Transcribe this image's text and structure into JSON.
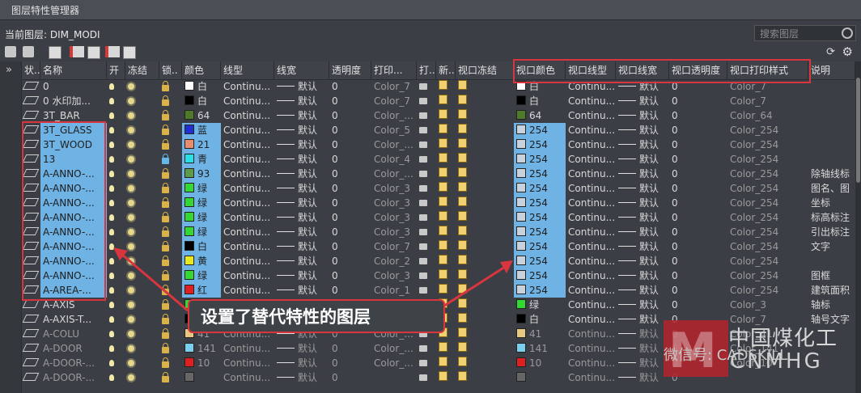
{
  "window": {
    "title": "图层特性管理器"
  },
  "current_layer": {
    "label": "当前图层: DIM_MODI"
  },
  "search": {
    "placeholder": "搜索图层"
  },
  "columns": [
    "状..",
    "名称",
    "开",
    "冻结",
    "锁..",
    "颜色",
    "线型",
    "线宽",
    "透明度",
    "打印...",
    "打..",
    "新..",
    "视口冻结",
    "视口颜色",
    "视口线型",
    "视口线宽",
    "视口透明度",
    "视口打印样式",
    "说明"
  ],
  "rows": [
    {
      "name": "0",
      "color": "白",
      "swatch": "#ffffff",
      "ltype": "Continu...",
      "lw": "默认",
      "tr": "0",
      "ps": "Color_7",
      "vpc": "白",
      "vpsw": "#ffffff",
      "vpl": "Continu...",
      "vplw": "默认",
      "vptr": "0",
      "vpps": "Color_7",
      "desc": "",
      "hl": false,
      "dim": false
    },
    {
      "name": "0 水印加...",
      "color": "白",
      "swatch": "#000000",
      "ltype": "Continu...",
      "lw": "默认",
      "tr": "0",
      "ps": "Color_7",
      "vpc": "白",
      "vpsw": "#000000",
      "vpl": "Continu...",
      "vplw": "默认",
      "vptr": "0",
      "vpps": "Color_7",
      "desc": "",
      "hl": false,
      "dim": false
    },
    {
      "name": "3T_BAR",
      "color": "64",
      "swatch": "#4e7a2a",
      "ltype": "Continu...",
      "lw": "默认",
      "tr": "0",
      "ps": "Color_...",
      "vpc": "64",
      "vpsw": "#4e7a2a",
      "vpl": "Continu...",
      "vplw": "默认",
      "vptr": "0",
      "vpps": "Color_64",
      "desc": "",
      "hl": false,
      "dim": false
    },
    {
      "name": "3T_GLASS",
      "color": "蓝",
      "swatch": "#2330d0",
      "ltype": "Continu...",
      "lw": "默认",
      "tr": "0",
      "ps": "Color_5",
      "vpc": "254",
      "vpsw": "#c8d2dc",
      "vpl": "Continu...",
      "vplw": "默认",
      "vptr": "0",
      "vpps": "Color_254",
      "desc": "",
      "hl": true,
      "dim": false
    },
    {
      "name": "3T_WOOD",
      "color": "21",
      "swatch": "#e58d6c",
      "ltype": "Continu...",
      "lw": "默认",
      "tr": "0",
      "ps": "Color_...",
      "vpc": "254",
      "vpsw": "#c8d2dc",
      "vpl": "Continu...",
      "vplw": "默认",
      "vptr": "0",
      "vpps": "Color_254",
      "desc": "",
      "hl": true,
      "dim": false
    },
    {
      "name": "13",
      "color": "青",
      "swatch": "#27e0e8",
      "ltype": "Continu...",
      "lw": "默认",
      "tr": "0",
      "ps": "Color_4",
      "vpc": "254",
      "vpsw": "#c8d2dc",
      "vpl": "Continu...",
      "vplw": "默认",
      "vptr": "0",
      "vpps": "Color_254",
      "desc": "",
      "hl": true,
      "dim": false
    },
    {
      "name": "A-ANNO-...",
      "color": "93",
      "swatch": "#5d9a4a",
      "ltype": "Continu...",
      "lw": "默认",
      "tr": "0",
      "ps": "Color_...",
      "vpc": "254",
      "vpsw": "#c8d2dc",
      "vpl": "Continu...",
      "vplw": "默认",
      "vptr": "0",
      "vpps": "Color_254",
      "desc": "除轴线标",
      "hl": true,
      "dim": false
    },
    {
      "name": "A-ANNO-...",
      "color": "绿",
      "swatch": "#33d833",
      "ltype": "Continu...",
      "lw": "默认",
      "tr": "0",
      "ps": "Color_3",
      "vpc": "254",
      "vpsw": "#c8d2dc",
      "vpl": "Continu...",
      "vplw": "默认",
      "vptr": "0",
      "vpps": "Color_254",
      "desc": "图名、图",
      "hl": true,
      "dim": false
    },
    {
      "name": "A-ANNO-...",
      "color": "绿",
      "swatch": "#33d833",
      "ltype": "Continu...",
      "lw": "默认",
      "tr": "0",
      "ps": "Color_3",
      "vpc": "254",
      "vpsw": "#c8d2dc",
      "vpl": "Continu...",
      "vplw": "默认",
      "vptr": "0",
      "vpps": "Color_254",
      "desc": "坐标",
      "hl": true,
      "dim": false
    },
    {
      "name": "A-ANNO-...",
      "color": "绿",
      "swatch": "#33d833",
      "ltype": "Continu...",
      "lw": "默认",
      "tr": "0",
      "ps": "Color_3",
      "vpc": "254",
      "vpsw": "#c8d2dc",
      "vpl": "Continu...",
      "vplw": "默认",
      "vptr": "0",
      "vpps": "Color_254",
      "desc": "标高标注",
      "hl": true,
      "dim": false
    },
    {
      "name": "A-ANNO-...",
      "color": "绿",
      "swatch": "#33d833",
      "ltype": "Continu...",
      "lw": "默认",
      "tr": "0",
      "ps": "Color_3",
      "vpc": "254",
      "vpsw": "#c8d2dc",
      "vpl": "Continu...",
      "vplw": "默认",
      "vptr": "0",
      "vpps": "Color_254",
      "desc": "引出标注",
      "hl": true,
      "dim": false
    },
    {
      "name": "A-ANNO-...",
      "color": "白",
      "swatch": "#000000",
      "ltype": "Continu...",
      "lw": "默认",
      "tr": "0",
      "ps": "Color_7",
      "vpc": "254",
      "vpsw": "#c8d2dc",
      "vpl": "Continu...",
      "vplw": "默认",
      "vptr": "0",
      "vpps": "Color_254",
      "desc": "文字",
      "hl": true,
      "dim": false
    },
    {
      "name": "A-ANNO-...",
      "color": "黄",
      "swatch": "#e8e820",
      "ltype": "Continu...",
      "lw": "默认",
      "tr": "0",
      "ps": "Color_2",
      "vpc": "254",
      "vpsw": "#c8d2dc",
      "vpl": "Continu...",
      "vplw": "默认",
      "vptr": "0",
      "vpps": "Color_254",
      "desc": "",
      "hl": true,
      "dim": false
    },
    {
      "name": "A-ANNO-...",
      "color": "绿",
      "swatch": "#33d833",
      "ltype": "Continu...",
      "lw": "默认",
      "tr": "0",
      "ps": "Color_3",
      "vpc": "254",
      "vpsw": "#c8d2dc",
      "vpl": "Continu...",
      "vplw": "默认",
      "vptr": "0",
      "vpps": "Color_254",
      "desc": "图框",
      "hl": true,
      "dim": false
    },
    {
      "name": "A-AREA-...",
      "color": "红",
      "swatch": "#e02020",
      "ltype": "Continu...",
      "lw": "默认",
      "tr": "0",
      "ps": "Color_1",
      "vpc": "254",
      "vpsw": "#c8d2dc",
      "vpl": "Continu...",
      "vplw": "默认",
      "vptr": "0",
      "vpps": "Color_254",
      "desc": "建筑面积",
      "hl": true,
      "dim": false
    },
    {
      "name": "A-AXIS",
      "color": "",
      "swatch": "#33d833",
      "ltype": "",
      "lw": "",
      "tr": "",
      "ps": "",
      "vpc": "绿",
      "vpsw": "#33d833",
      "vpl": "Continu...",
      "vplw": "默认",
      "vptr": "0",
      "vpps": "Color_3",
      "desc": "轴标",
      "hl": false,
      "dim": false
    },
    {
      "name": "A-AXIS-T...",
      "color": "",
      "swatch": "#000000",
      "ltype": "",
      "lw": "",
      "tr": "",
      "ps": "",
      "vpc": "白",
      "vpsw": "#000000",
      "vpl": "Continu...",
      "vplw": "默认",
      "vptr": "0",
      "vpps": "Color_7",
      "desc": "轴号文字",
      "hl": false,
      "dim": false
    },
    {
      "name": "A-COLU",
      "color": "41",
      "swatch": "#e8c880",
      "ltype": "Continu...",
      "lw": "默认",
      "tr": "0",
      "ps": "Color_...",
      "vpc": "41",
      "vpsw": "#e8c880",
      "vpl": "Continu...",
      "vplw": "默认",
      "vptr": "0",
      "vpps": "Color_41",
      "desc": "",
      "hl": false,
      "dim": true
    },
    {
      "name": "A-DOOR",
      "color": "141",
      "swatch": "#7ad0ec",
      "ltype": "Continu...",
      "lw": "默认",
      "tr": "0",
      "ps": "Color_...",
      "vpc": "141",
      "vpsw": "#7ad0ec",
      "vpl": "Continu...",
      "vplw": "默认",
      "vptr": "0",
      "vpps": "Color_141",
      "desc": "",
      "hl": false,
      "dim": true
    },
    {
      "name": "A-DOOR-...",
      "color": "10",
      "swatch": "#e02020",
      "ltype": "Continu...",
      "lw": "默认",
      "tr": "0",
      "ps": "Color_...",
      "vpc": "10",
      "vpsw": "#e02020",
      "vpl": "Continu...",
      "vplw": "默认",
      "vptr": "0",
      "vpps": "Color_10",
      "desc": "",
      "hl": false,
      "dim": true
    },
    {
      "name": "A-DOOR-...",
      "color": "",
      "swatch": "#666666",
      "ltype": "Continu...",
      "lw": "默认",
      "tr": "0",
      "ps": "",
      "vpc": "",
      "vpsw": "#666666",
      "vpl": "Continu...",
      "vplw": "默认",
      "vptr": "0",
      "vpps": "",
      "desc": "",
      "hl": false,
      "dim": true
    }
  ],
  "callout": {
    "text": "设置了替代特性的图层"
  },
  "watermark": {
    "line1": "中国煤化工",
    "line2": "CNMHG",
    "wechat": "微信号: CADSKILL"
  }
}
